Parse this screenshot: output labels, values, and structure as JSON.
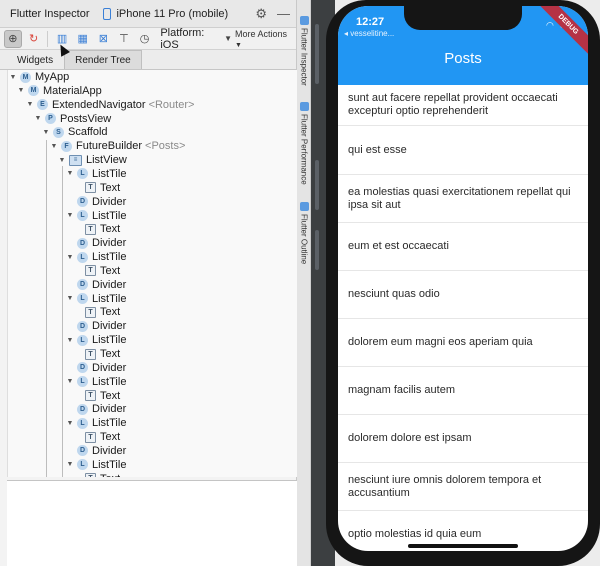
{
  "window": {
    "title": "Flutter Inspector",
    "device": "iPhone 11 Pro (mobile)"
  },
  "toolbar": {
    "platform_label": "Platform: iOS",
    "more_actions": "More Actions"
  },
  "tabs": [
    {
      "label": "Widgets",
      "active": false
    },
    {
      "label": "Render Tree",
      "active": true
    }
  ],
  "tree": [
    {
      "icon": "M",
      "name": "MyApp",
      "extra": ""
    },
    {
      "icon": "M",
      "name": "MaterialApp",
      "extra": ""
    },
    {
      "icon": "E",
      "name": "ExtendedNavigator",
      "extra": "<Router>"
    },
    {
      "icon": "P",
      "name": "PostsView",
      "extra": ""
    },
    {
      "icon": "S",
      "name": "Scaffold",
      "extra": ""
    },
    {
      "icon": "F",
      "name": "FutureBuilder",
      "extra": "<Posts>"
    },
    {
      "icon": "LV",
      "name": "ListView",
      "extra": ""
    },
    {
      "icon": "L",
      "name": "ListTile",
      "extra": ""
    },
    {
      "icon": "T",
      "name": "Text",
      "extra": ""
    },
    {
      "icon": "D",
      "name": "Divider",
      "extra": ""
    },
    {
      "icon": "L",
      "name": "ListTile",
      "extra": ""
    },
    {
      "icon": "T",
      "name": "Text",
      "extra": ""
    },
    {
      "icon": "D",
      "name": "Divider",
      "extra": ""
    },
    {
      "icon": "L",
      "name": "ListTile",
      "extra": ""
    },
    {
      "icon": "T",
      "name": "Text",
      "extra": ""
    },
    {
      "icon": "D",
      "name": "Divider",
      "extra": ""
    },
    {
      "icon": "L",
      "name": "ListTile",
      "extra": ""
    },
    {
      "icon": "T",
      "name": "Text",
      "extra": ""
    },
    {
      "icon": "D",
      "name": "Divider",
      "extra": ""
    },
    {
      "icon": "L",
      "name": "ListTile",
      "extra": ""
    },
    {
      "icon": "T",
      "name": "Text",
      "extra": ""
    },
    {
      "icon": "D",
      "name": "Divider",
      "extra": ""
    },
    {
      "icon": "L",
      "name": "ListTile",
      "extra": ""
    },
    {
      "icon": "T",
      "name": "Text",
      "extra": ""
    },
    {
      "icon": "D",
      "name": "Divider",
      "extra": ""
    },
    {
      "icon": "L",
      "name": "ListTile",
      "extra": ""
    },
    {
      "icon": "T",
      "name": "Text",
      "extra": ""
    },
    {
      "icon": "D",
      "name": "Divider",
      "extra": ""
    },
    {
      "icon": "L",
      "name": "ListTile",
      "extra": ""
    },
    {
      "icon": "T",
      "name": "Text",
      "extra": ""
    }
  ],
  "tool_windows": [
    "Flutter Inspector",
    "Flutter Performance",
    "Flutter Outline"
  ],
  "phone": {
    "time": "12:27",
    "back_app": "◂ vesselitine...",
    "app_title": "Posts",
    "debug_banner": "DEBUG",
    "posts": [
      "sunt aut facere repellat provident occaecati excepturi optio reprehenderit",
      "qui est esse",
      "ea molestias quasi exercitationem repellat qui ipsa sit aut",
      "eum et est occaecati",
      "nesciunt quas odio",
      "dolorem eum magni eos aperiam quia",
      "magnam facilis autem",
      "dolorem dolore est ipsam",
      "nesciunt iure omnis dolorem tempora et accusantium",
      "optio molestias id quia eum"
    ]
  },
  "colors": {
    "app_bar": "#2196f3",
    "debug_banner": "#b53245",
    "phone_frame": "#151515"
  }
}
